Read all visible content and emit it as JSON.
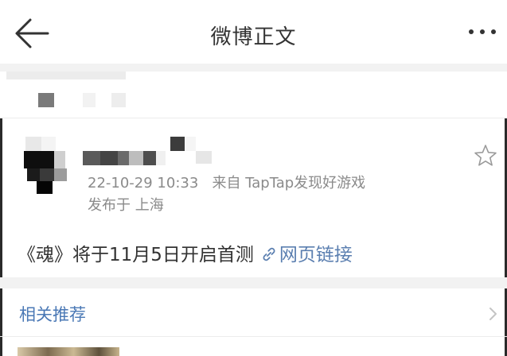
{
  "nav": {
    "title": "微博正文",
    "back_icon": "arrow-left-icon",
    "more_icon": "more-dots-icon"
  },
  "post": {
    "timestamp": "22-10-29 10:33",
    "source_prefix": "来自",
    "source": "TapTap发现好游戏",
    "location_prefix": "发布于",
    "location": "上海",
    "text": "《魂》将于11月5日开启首测",
    "link_label": "网页链接",
    "link_icon": "link-icon",
    "favorite_icon": "star-outline-icon"
  },
  "related": {
    "title": "相关推荐",
    "chevron_icon": "chevron-right-icon"
  },
  "colors": {
    "link": "#5b7fb0",
    "related_title": "#4a78b5",
    "meta_text": "#8a8a8a",
    "band": "#f2f2f2"
  }
}
